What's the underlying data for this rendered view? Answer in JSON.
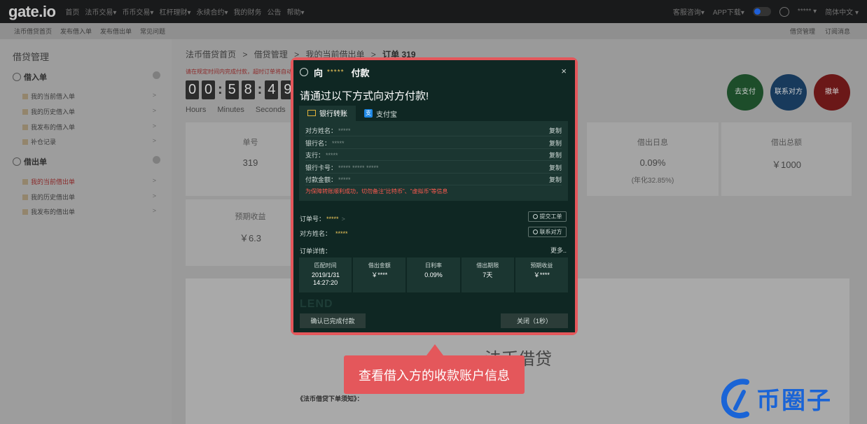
{
  "topnav": {
    "logo": "gate.io",
    "items": [
      "首页",
      "法币交易▾",
      "币币交易▾",
      "杠杆理财▾",
      "永续合约▾",
      "我的财务",
      "公告",
      "帮助▾"
    ],
    "right": {
      "support": "客服咨询▾",
      "app": "APP下载▾",
      "user": "*****  ▾",
      "lang": "简体中文 ▾"
    }
  },
  "subnav": {
    "items": [
      "法币借贷首页",
      "发布借入单",
      "发布借出单",
      "常见问题"
    ],
    "right": {
      "manage": "借贷管理",
      "subscribe": "订阅消息"
    }
  },
  "sidebar": {
    "title": "借贷管理",
    "borrow_group": "借入单",
    "borrow_items": [
      "我的当前借入单",
      "我的历史借入单",
      "我发布的借入单",
      "补仓记录"
    ],
    "lend_group": "借出单",
    "lend_items": [
      "我的当前借出单",
      "我的历史借出单",
      "我发布的借出单"
    ]
  },
  "breadcrumb": {
    "parts": [
      "法币借贷首页",
      "借贷管理",
      "我的当前借出单"
    ],
    "sep": ">",
    "current": "订单 319"
  },
  "warning": "请在规定时间内完成付款，超时订单将自动取消",
  "timer": {
    "digits": [
      "0",
      "0",
      "5",
      "8",
      "4",
      "9"
    ],
    "labels": [
      "Hours",
      "Minutes",
      "Seconds"
    ]
  },
  "actions": {
    "pay": "去支付",
    "contact": "联系对方",
    "cancel": "撤单"
  },
  "stats": {
    "order_no": {
      "label": "单号",
      "value": "319"
    },
    "daily_rate": {
      "label": "借出日息",
      "value": "0.09%",
      "sub": "(年化32.85%)"
    },
    "total": {
      "label": "借出总额",
      "value": "￥1000"
    },
    "expected": {
      "label": "预期收益",
      "value": "￥6.3"
    }
  },
  "panel": {
    "title": "法币借贷",
    "notice": "《法币借贷下单须知》："
  },
  "watermark": {
    "text": "币圈子"
  },
  "modal": {
    "to": "向",
    "masked": "*****",
    "pay": "付款",
    "close": "×",
    "main_title": "请通过以下方式向对方付款!",
    "tabs": [
      "银行转账",
      "支付宝"
    ],
    "bank": [
      {
        "label": "对方姓名：",
        "value": "*****",
        "copy": "复制"
      },
      {
        "label": "银行名：",
        "value": "*****",
        "copy": "复制"
      },
      {
        "label": "支行：",
        "value": "*****",
        "copy": "复制"
      },
      {
        "label": "银行卡号：",
        "value": "***** ***** *****",
        "copy": "复制"
      },
      {
        "label": "付款金额：",
        "value": "*****",
        "copy": "复制"
      }
    ],
    "bank_warning": "为保障转账顺利成功，切勿备注\"比特币\"、\"虚拟币\"等信息",
    "order_no_label": "订单号：",
    "order_no_value": "*****",
    "order_chev": ">",
    "submit_ticket": "提交工单",
    "cp_name_label": "对方姓名：",
    "cp_name_value": "*****",
    "contact": "联系对方",
    "detail_label": "订单详情：",
    "more": "更多..",
    "table": [
      {
        "h": "匹配时间",
        "v": "2019/1/31 14:27:20"
      },
      {
        "h": "借出金额",
        "v": "￥****"
      },
      {
        "h": "日利率",
        "v": "0.09%"
      },
      {
        "h": "借出期限",
        "v": "7天"
      },
      {
        "h": "预期收益",
        "v": "￥****"
      }
    ],
    "lend_mark": "LEND",
    "confirm": "确认已完成付款",
    "close_btn": "关闭（1秒）"
  },
  "callout": {
    "text": "查看借入方的收款账户信息"
  },
  "colors": {
    "accent": "#e4575b",
    "modal_bg": "#0f2723",
    "modal_panel": "#1b3631",
    "mask_gold": "#f0c85a",
    "warn_red": "#ff5a4f"
  }
}
